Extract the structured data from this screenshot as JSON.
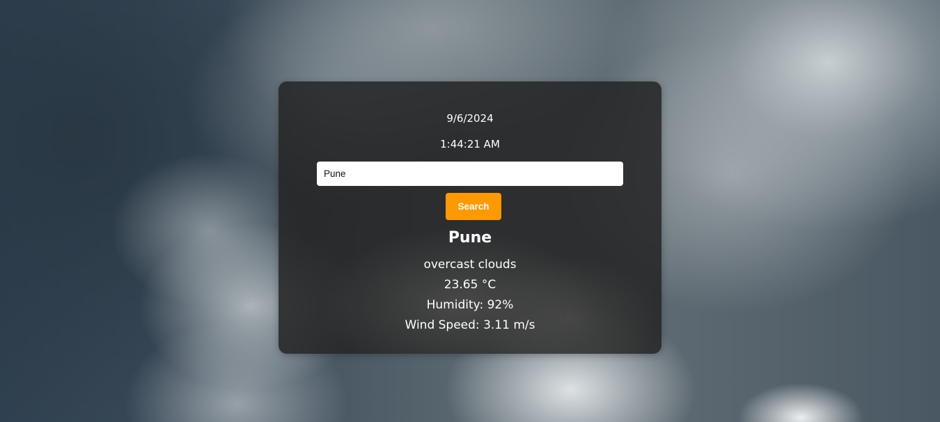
{
  "weather_card": {
    "date": "9/6/2024",
    "time": "1:44:21 AM",
    "search": {
      "value": "Pune",
      "button_label": "Search"
    },
    "result": {
      "city": "Pune",
      "description": "overcast clouds",
      "temperature": "23.65 °C",
      "humidity": "Humidity: 92%",
      "wind_speed": "Wind Speed: 3.11 m/s"
    }
  },
  "colors": {
    "accent": "#ff9900",
    "card_background": "#242424",
    "text": "#ffffff"
  }
}
